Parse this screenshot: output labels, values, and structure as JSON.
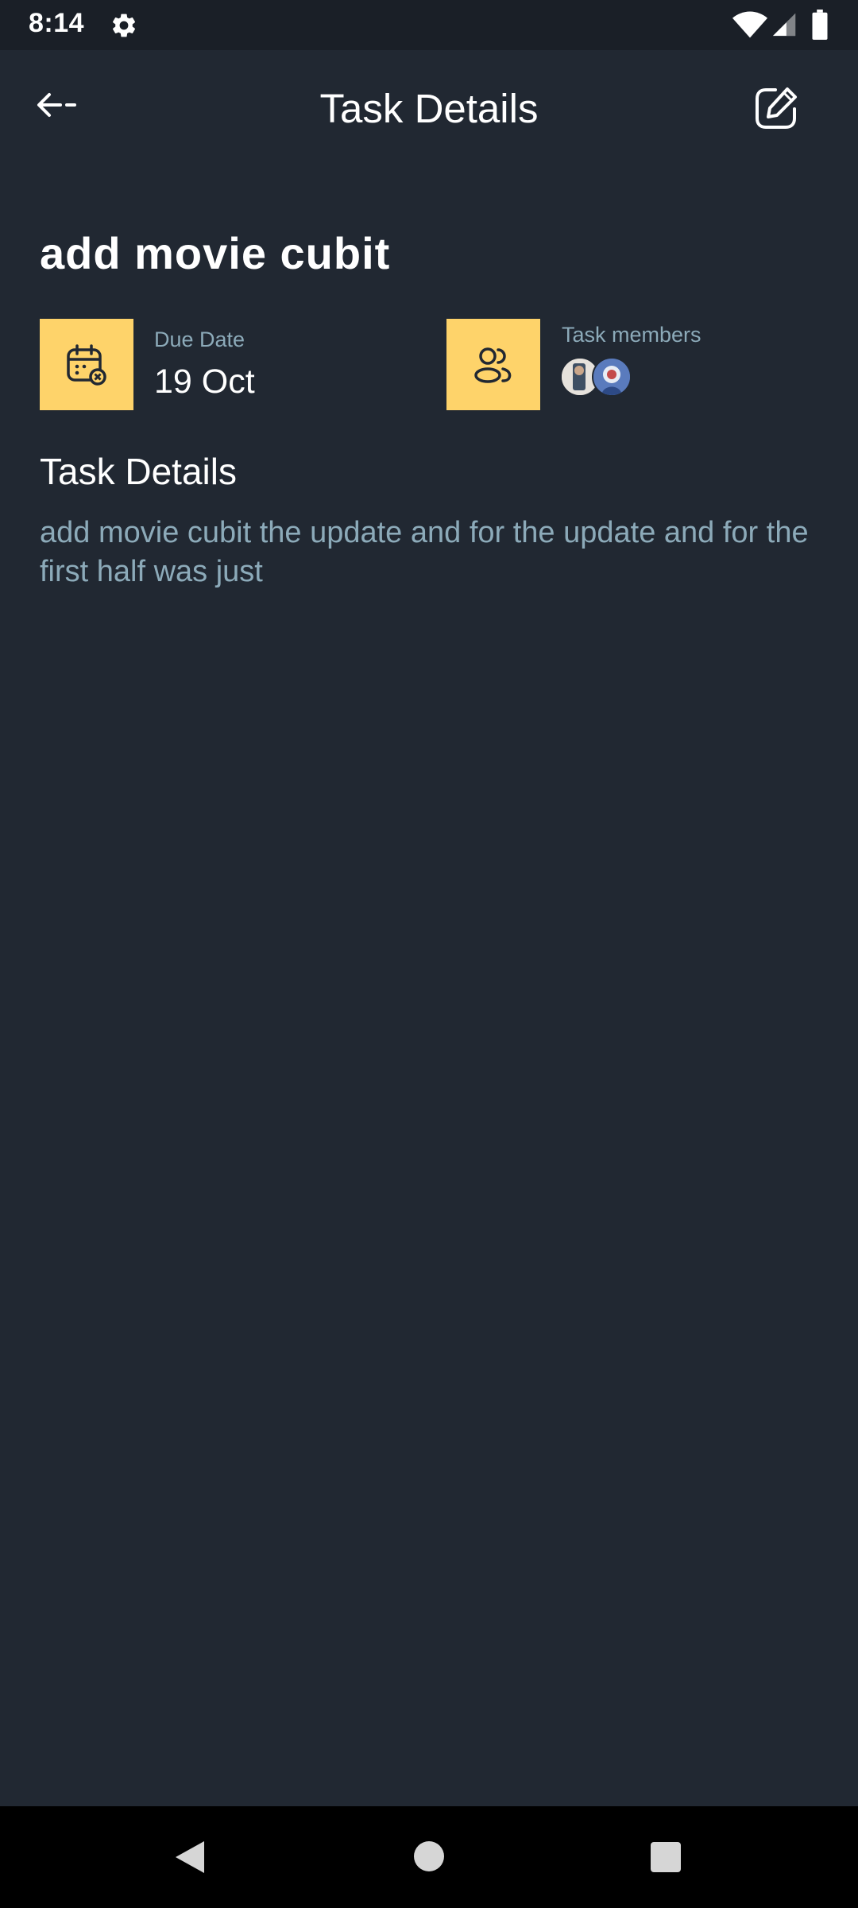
{
  "status_bar": {
    "time": "8:14"
  },
  "app_bar": {
    "title": "Task Details"
  },
  "task": {
    "title": "add movie cubit",
    "due_date_label": "Due Date",
    "due_date_value": "19 Oct",
    "members_label": "Task members",
    "details_heading": "Task Details",
    "description": "add movie cubit the update and for the update and for the first half was just"
  },
  "colors": {
    "background": "#212832",
    "accent": "#fed36a",
    "muted_text": "#8caab9"
  },
  "icons": {
    "settings": "gear-icon",
    "wifi": "wifi-icon",
    "signal": "signal-icon",
    "battery": "battery-icon",
    "back": "back-arrow-icon",
    "edit": "edit-icon",
    "calendar": "calendar-icon",
    "members": "users-icon"
  }
}
